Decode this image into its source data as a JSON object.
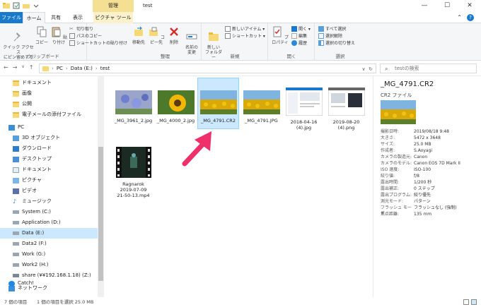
{
  "window": {
    "title": "test",
    "context_tab_group": "管理",
    "minimize": "—",
    "maximize": "☐",
    "close": "✕"
  },
  "tabs": {
    "file": "ファイル",
    "home": "ホーム",
    "share": "共有",
    "view": "表示",
    "picture_tools": "ピクチャ ツール"
  },
  "ribbon": {
    "clipboard": {
      "label": "クリップボード",
      "quick_access": "クイック アクセス\nにピン留めする",
      "copy": "コピー",
      "paste": "貼り付け",
      "cut": "切り取り",
      "copy_path": "パスのコピー",
      "paste_shortcut": "ショートカットの貼り付け"
    },
    "organize": {
      "label": "整理",
      "move_to": "移動先",
      "copy_to": "コピー先",
      "delete": "削除",
      "rename": "名前の\n変更"
    },
    "new": {
      "label": "新規",
      "new_folder": "新しい\nフォルダー",
      "new_item": "新しいアイテム ▾",
      "shortcut": "ショートカット ▾"
    },
    "open": {
      "label": "開く",
      "properties": "プロパティ",
      "open": "開く ▾",
      "edit": "編集",
      "history": "履歴"
    },
    "select": {
      "label": "選択",
      "select_all": "すべて選択",
      "select_none": "選択解除",
      "invert": "選択の切り替え"
    }
  },
  "address": {
    "path": [
      "PC",
      "Data (E:)",
      "test"
    ],
    "search_placeholder": "testの検索"
  },
  "nav": {
    "items": [
      {
        "label": "ドキュメント",
        "icon": "folder-icon"
      },
      {
        "label": "画像",
        "icon": "folder-icon"
      },
      {
        "label": "公開",
        "icon": "folder-icon"
      },
      {
        "label": "電子メールの添付ファイル",
        "icon": "folder-icon"
      },
      {
        "label": "PC",
        "icon": "pc-icon"
      },
      {
        "label": "3D オブジェクト",
        "icon": "3d-objects-icon"
      },
      {
        "label": "ダウンロード",
        "icon": "download-icon"
      },
      {
        "label": "デスクトップ",
        "icon": "desktop-icon"
      },
      {
        "label": "ドキュメント",
        "icon": "documents-icon"
      },
      {
        "label": "ピクチャ",
        "icon": "pictures-icon"
      },
      {
        "label": "ビデオ",
        "icon": "videos-icon"
      },
      {
        "label": "ミュージック",
        "icon": "music-icon"
      },
      {
        "label": "System (C:)",
        "icon": "drive-icon"
      },
      {
        "label": "Application (D:)",
        "icon": "drive-icon"
      },
      {
        "label": "Data (E:)",
        "icon": "drive-icon"
      },
      {
        "label": "Data2 (F:)",
        "icon": "drive-icon"
      },
      {
        "label": "Work (G:)",
        "icon": "drive-icon"
      },
      {
        "label": "Work2 (H:)",
        "icon": "drive-icon"
      },
      {
        "label": "share (¥¥192.168.1.18) (Z:)",
        "icon": "network-drive-icon"
      },
      {
        "label": "ネットワーク",
        "icon": "network-icon"
      },
      {
        "label": "Catch!",
        "icon": "catch-icon"
      }
    ]
  },
  "files": [
    {
      "name": "_MG_3961_2.jpg",
      "kind": "flowers"
    },
    {
      "name": "_MG_4000_2.jpg",
      "kind": "sunflower-close"
    },
    {
      "name": "_MG_4791.CR2",
      "kind": "sunflower-field"
    },
    {
      "name": "_MG_4791.JPG",
      "kind": "sunflower-field"
    },
    {
      "name": "2018-04-16\n(4).jpg",
      "kind": "screenshot"
    },
    {
      "name": "2019-08-20\n(4).png",
      "kind": "screenshot2"
    },
    {
      "name": "Ragnarok\n2019-07-09\n21-50-13.mp4",
      "kind": "video"
    }
  ],
  "details": {
    "title": "_MG_4791.CR2",
    "type": "CR2 ファイル",
    "props": [
      {
        "k": "撮影日時:",
        "v": "2019/08/18 9:48"
      },
      {
        "k": "大きさ:",
        "v": "5472 x 3648"
      },
      {
        "k": "サイズ:",
        "v": "25.0 MB"
      },
      {
        "k": "作成者:",
        "v": "S.Aoyagi"
      },
      {
        "k": "カメラの製造元:",
        "v": "Canon"
      },
      {
        "k": "カメラのモデル:",
        "v": "Canon EOS 7D Mark II"
      },
      {
        "k": "ISO 速度:",
        "v": "ISO-100"
      },
      {
        "k": "絞り値:",
        "v": "f/8"
      },
      {
        "k": "露出時間:",
        "v": "1/200 秒"
      },
      {
        "k": "露出補正:",
        "v": "0 ステップ"
      },
      {
        "k": "露出プログラム:",
        "v": "絞り優先"
      },
      {
        "k": "測光モード:",
        "v": "パターン"
      },
      {
        "k": "フラッシュ モード:",
        "v": "フラッシュなし (強制)"
      },
      {
        "k": "焦点距離:",
        "v": "135 mm"
      }
    ]
  },
  "status": {
    "count": "7 個の項目",
    "selection": "1 個の項目を選択 25.0 MB"
  },
  "colors": {
    "accent": "#1979ca",
    "selection": "#cce8ff",
    "context_tab": "#f5df93",
    "arrow": "#f0306a"
  }
}
